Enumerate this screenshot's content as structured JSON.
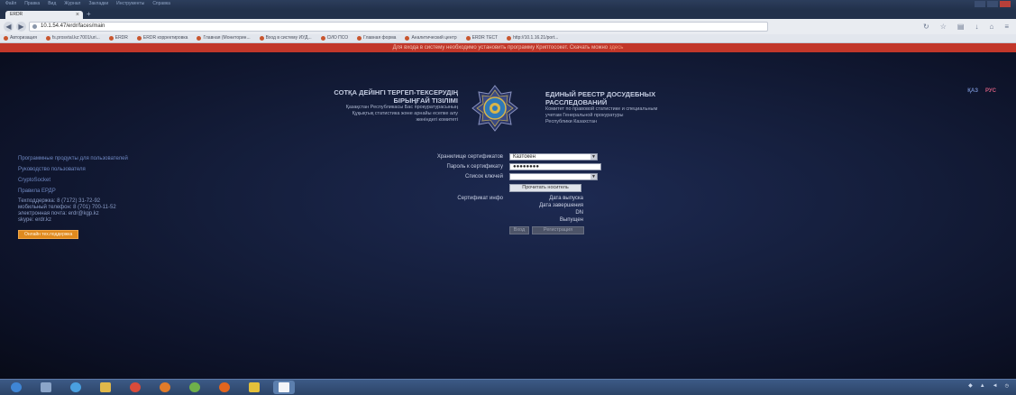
{
  "browser": {
    "menu": [
      "Файл",
      "Правка",
      "Вид",
      "Журнал",
      "Закладки",
      "Инструменты",
      "Справка"
    ],
    "tab_title": "ERDR",
    "tab_close": "×",
    "new_tab": "+",
    "url": "10.1.54.47/erdr/faces/main",
    "bookmarks": [
      "Авторизация",
      "fs.prosvtal.kz:7001/uri...",
      "ERDR",
      "ERDR корректировка",
      "Главная (Мониторин...",
      "Вход в систему ИУД...",
      "СИО ПСО",
      "Главная форма",
      "Аналитический центр",
      "ERDR ТЕСТ",
      "http://10.1.16.21/port..."
    ]
  },
  "notice": {
    "text": "Для входа в систему необходимо установить программу Криптосокет. Скачать можно ",
    "link": "здесь"
  },
  "lang": {
    "kz": "ҚАЗ",
    "ru": "РУС"
  },
  "header_kz": {
    "line1": "СОТҚА ДЕЙІНГІ ТЕРГЕП-ТЕКСЕРУДІҢ",
    "line2": "БІРЫҢҒАЙ ТІЗІЛІМІ",
    "line3": "Қазақстан Республикасы Бас прокуратурасының",
    "line4": "Құқықтық статистика және арнайы есепке алу",
    "line5": "жөніндегі комитеті"
  },
  "header_ru": {
    "line1": "ЕДИНЫЙ РЕЕСТР ДОСУДЕБНЫХ",
    "line2": "РАССЛЕДОВАНИЙ",
    "line3": "Комитет по правовой статистике и специальным",
    "line4": "учетам Генеральной прокуратуры",
    "line5": "Республики Казахстан"
  },
  "left_menu": {
    "items": [
      "Программные продукты для пользователей",
      "Руководство пользователя",
      "CryptoSocket",
      "Правила ЕРДР"
    ],
    "contacts": [
      "Техподдержка: 8 (7172) 31-72-92",
      "мобильный телефон: 8 (701) 700-11-52",
      "электронная почта: erdr@kgp.kz",
      "skype: erdr.kz"
    ],
    "support_button": "Онлайн тех.поддержка"
  },
  "form": {
    "store_label": "Хранилище сертификатов",
    "store_value": "Казтокен",
    "password_label": "Пароль к сертификату",
    "password_value": "●●●●●●●●",
    "keys_label": "Список ключей",
    "keys_value": "",
    "read_button": "Прочитать носитель",
    "cert_info_label": "Сертификат инфо",
    "info_fields": [
      "Дата выпуска",
      "Дата завершения",
      "DN",
      "Выпущен"
    ],
    "login_button": "Вход",
    "register_button": "Регистрация"
  },
  "colors": {
    "notice_bg": "#c2372a",
    "link": "#6f88c2",
    "support_btn": "#e08a1e",
    "taskbar": "#2b4468"
  }
}
